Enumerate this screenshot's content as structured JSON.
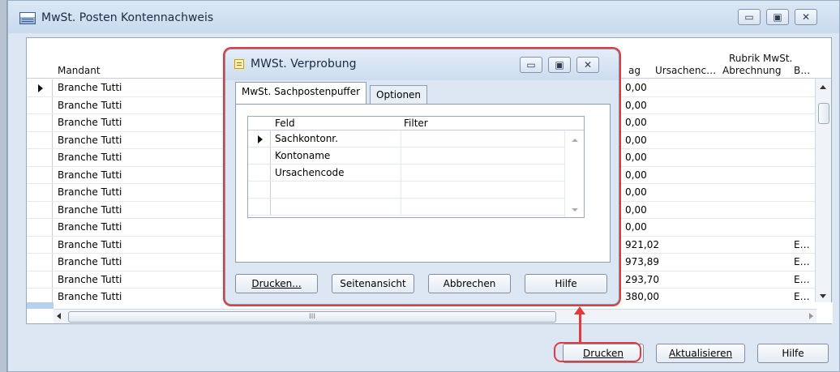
{
  "main_window": {
    "title": "MwSt. Posten Kontennachweis",
    "controls": {
      "minimize": "▭",
      "maximize": "▣",
      "close": "✕"
    }
  },
  "grid": {
    "columns": {
      "mandant": "Mandant",
      "betrag_partial": "ag",
      "ursachencode": "Ursachenc…",
      "rubrik_line1": "Rubrik MwSt.",
      "rubrik_line2": "Abrechnung",
      "b": "B…"
    },
    "rows": [
      {
        "mandant": "Branche Tutti",
        "betrag": "0,00",
        "b": ""
      },
      {
        "mandant": "Branche Tutti",
        "betrag": "0,00",
        "b": ""
      },
      {
        "mandant": "Branche Tutti",
        "betrag": "0,00",
        "b": ""
      },
      {
        "mandant": "Branche Tutti",
        "betrag": "0,00",
        "b": ""
      },
      {
        "mandant": "Branche Tutti",
        "betrag": "0,00",
        "b": ""
      },
      {
        "mandant": "Branche Tutti",
        "betrag": "0,00",
        "b": ""
      },
      {
        "mandant": "Branche Tutti",
        "betrag": "0,00",
        "b": ""
      },
      {
        "mandant": "Branche Tutti",
        "betrag": "0,00",
        "b": ""
      },
      {
        "mandant": "Branche Tutti",
        "betrag": "0,00",
        "b": ""
      },
      {
        "mandant": "Branche Tutti",
        "betrag": "921,02",
        "b": "E…"
      },
      {
        "mandant": "Branche Tutti",
        "betrag": "973,89",
        "b": "E…"
      },
      {
        "mandant": "Branche Tutti",
        "betrag": "293,70",
        "b": "E…"
      },
      {
        "mandant": "Branche Tutti",
        "betrag": "380,00",
        "b": "E…"
      }
    ],
    "hscroll_grip": "III"
  },
  "main_buttons": {
    "print": "Drucken",
    "refresh": "Aktualisieren",
    "help": "Hilfe"
  },
  "dialog": {
    "title": "MWSt. Verprobung",
    "tabs": [
      "MwSt. Sachpostenpuffer",
      "Optionen"
    ],
    "filter_grid": {
      "col_field": "Feld",
      "col_filter": "Filter",
      "rows": [
        "Sachkontonr.",
        "Kontoname",
        "Ursachencode",
        "",
        ""
      ]
    },
    "buttons": {
      "print": "Drucken...",
      "preview": "Seitenansicht",
      "cancel": "Abbrechen",
      "help": "Hilfe"
    }
  },
  "annotation_color": "#e33b3b"
}
